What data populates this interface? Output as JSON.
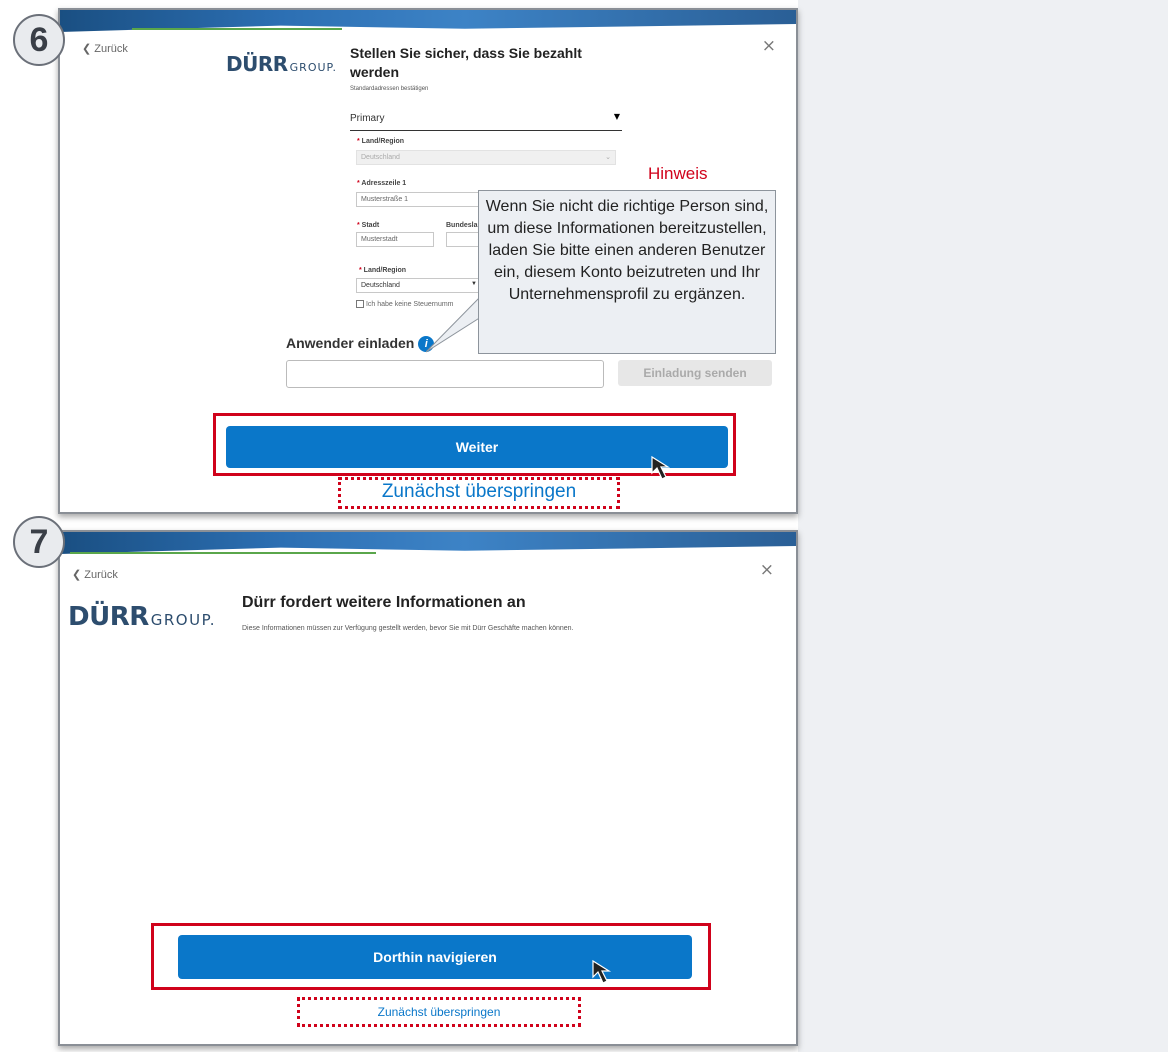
{
  "step6": {
    "badge": "6",
    "back_label": "Zurück",
    "close_glyph": "×",
    "logo_main": "DÜRR",
    "logo_sub": "GROUP.",
    "title_line1": "Stellen Sie sicher, dass Sie bezahlt",
    "title_line2": "werden",
    "subtitle": "Standardadressen bestätigen",
    "address_select": "Primary",
    "country_label": "Land/Region",
    "country_value": "Deutschland",
    "address_label": "Adresszeile 1",
    "address_value": "Musterstraße 1",
    "city_label": "Stadt",
    "city_value": "Musterstadt",
    "state_label": "Bundeslan",
    "tax_country_label": "Land/Region",
    "tax_country_value": "Deutschland",
    "no_tax_checkbox": "Ich habe keine Steuernumm",
    "invite_label": "Anwender einladen",
    "info_icon": "i",
    "invite_send_button": "Einladung senden",
    "continue_button": "Weiter",
    "skip_link": "Zunächst überspringen"
  },
  "annotation": {
    "title": "Hinweis",
    "text": "Wenn Sie nicht die richtige Person sind, um diese Informationen bereitzustellen, laden Sie bitte einen anderen Benutzer ein, diesem Konto beizutreten und Ihr Unternehmensprofil zu ergänzen."
  },
  "step7": {
    "badge": "7",
    "back_label": "Zurück",
    "close_glyph": "×",
    "logo_main": "DÜRR",
    "logo_sub": "GROUP.",
    "title": "Dürr fordert weitere Informationen an",
    "description": "Diese Informationen müssen zur Verfügung gestellt werden, bevor Sie mit Dürr Geschäfte machen können.",
    "navigate_button": "Dorthin navigieren",
    "skip_link": "Zunächst überspringen"
  },
  "colors": {
    "accent_blue": "#0a77c9",
    "highlight_red": "#d0021b",
    "progress_green": "#5aa64b",
    "logo_navy": "#2d4d6e"
  }
}
